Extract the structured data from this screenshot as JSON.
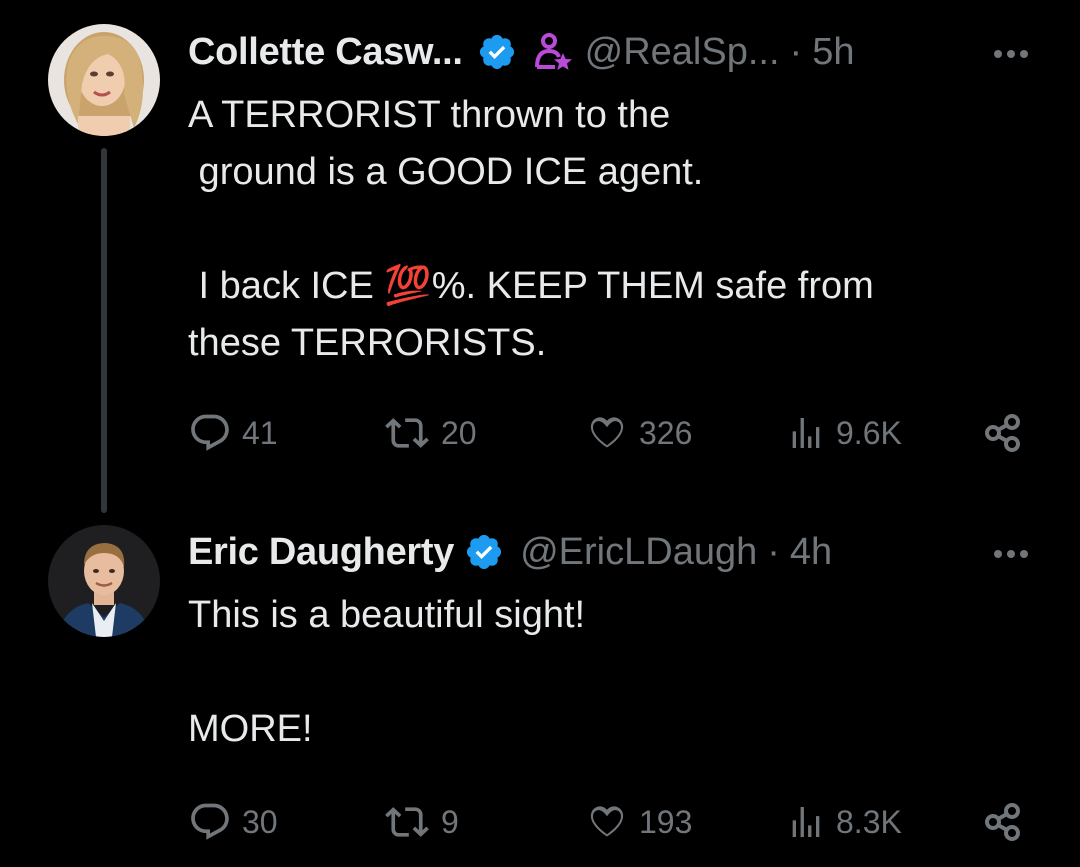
{
  "thread": [
    {
      "author_name": "Collette Casw...",
      "handle": "@RealSp...",
      "separator": "·",
      "time": "5h",
      "text": "A TERRORIST thrown to the\n ground is a GOOD ICE agent.\n\n I back ICE 💯%. KEEP THEM safe from\nthese TERRORISTS.",
      "stats": {
        "replies": "41",
        "reposts": "20",
        "likes": "326",
        "views": "9.6K"
      },
      "icons": [
        "verified-badge-icon",
        "affiliate-person-star-icon",
        "more-icon",
        "reply-icon",
        "repost-icon",
        "like-icon",
        "views-icon",
        "share-icon"
      ]
    },
    {
      "author_name": "Eric Daugherty",
      "handle": "@EricLDaugh",
      "separator": "·",
      "time": "4h",
      "text": "This is a beautiful sight!\n\nMORE!",
      "stats": {
        "replies": "30",
        "reposts": "9",
        "likes": "193",
        "views": "8.3K"
      },
      "icons": [
        "verified-badge-icon",
        "more-icon",
        "reply-icon",
        "repost-icon",
        "like-icon",
        "views-icon",
        "share-icon"
      ]
    }
  ],
  "colors": {
    "background": "#000000",
    "text_primary": "#e7e9ea",
    "text_secondary": "#71767b",
    "verified_blue": "#1d9bf0",
    "affiliate_purple": "#b94bd8",
    "thread_line": "#333639"
  }
}
